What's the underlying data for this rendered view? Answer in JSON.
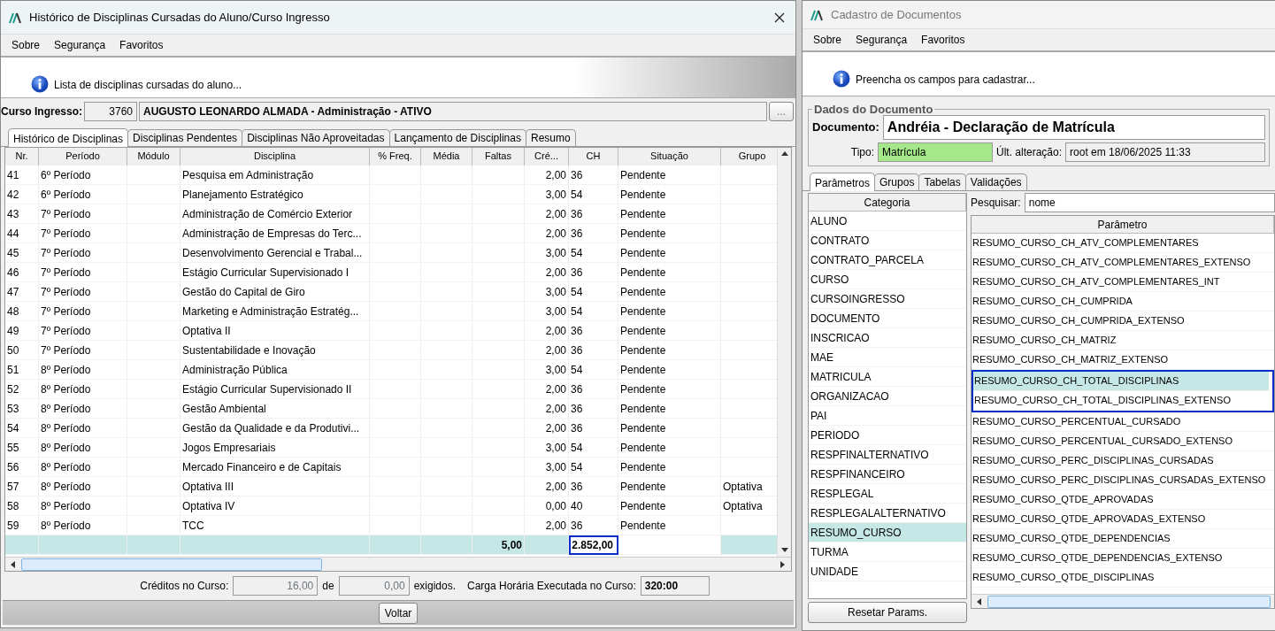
{
  "left_window": {
    "title": "Histórico de Disciplinas Cursadas do Aluno/Curso Ingresso",
    "menu": [
      "Sobre",
      "Segurança",
      "Favoritos"
    ],
    "info": "Lista de disciplinas cursadas do aluno...",
    "curso_ingresso": {
      "label": "Curso Ingresso:",
      "code": "3760",
      "name": "AUGUSTO LEONARDO ALMADA - Administração - ATIVO",
      "button": "..."
    },
    "tabs": [
      {
        "label": "Histórico de Disciplinas",
        "selected": true
      },
      {
        "label": "Disciplinas Pendentes",
        "selected": false
      },
      {
        "label": "Disciplinas Não Aproveitadas",
        "selected": false
      },
      {
        "label": "Lançamento de Disciplinas",
        "selected": false
      },
      {
        "label": "Resumo",
        "selected": false
      }
    ],
    "table": {
      "columns": [
        "Nr.",
        "Período",
        "Módulo",
        "Disciplina",
        "% Freq.",
        "Média",
        "Faltas",
        "Cré...",
        "CH",
        "Situação",
        "Grupo"
      ],
      "rows": [
        {
          "nr": "41",
          "periodo": "6º Período",
          "disciplina": "Pesquisa em Administração",
          "creditos": "2,00",
          "ch": "36",
          "situacao": "Pendente"
        },
        {
          "nr": "42",
          "periodo": "6º Período",
          "disciplina": "Planejamento Estratégico",
          "creditos": "3,00",
          "ch": "54",
          "situacao": "Pendente"
        },
        {
          "nr": "43",
          "periodo": "7º Período",
          "disciplina": "Administração de Comércio Exterior",
          "creditos": "2,00",
          "ch": "36",
          "situacao": "Pendente"
        },
        {
          "nr": "44",
          "periodo": "7º Período",
          "disciplina": "Administração de Empresas do Terc...",
          "creditos": "2,00",
          "ch": "36",
          "situacao": "Pendente"
        },
        {
          "nr": "45",
          "periodo": "7º Período",
          "disciplina": "Desenvolvimento Gerencial e Trabal...",
          "creditos": "3,00",
          "ch": "54",
          "situacao": "Pendente"
        },
        {
          "nr": "46",
          "periodo": "7º Período",
          "disciplina": "Estágio Curricular Supervisionado I",
          "creditos": "2,00",
          "ch": "36",
          "situacao": "Pendente"
        },
        {
          "nr": "47",
          "periodo": "7º Período",
          "disciplina": "Gestão do Capital de Giro",
          "creditos": "3,00",
          "ch": "54",
          "situacao": "Pendente"
        },
        {
          "nr": "48",
          "periodo": "7º Período",
          "disciplina": "Marketing e Administração Estratég...",
          "creditos": "3,00",
          "ch": "54",
          "situacao": "Pendente"
        },
        {
          "nr": "49",
          "periodo": "7º Período",
          "disciplina": "Optativa II",
          "creditos": "2,00",
          "ch": "36",
          "situacao": "Pendente"
        },
        {
          "nr": "50",
          "periodo": "7º Período",
          "disciplina": "Sustentabilidade e Inovação",
          "creditos": "2,00",
          "ch": "36",
          "situacao": "Pendente"
        },
        {
          "nr": "51",
          "periodo": "8º Período",
          "disciplina": "Administração Pública",
          "creditos": "3,00",
          "ch": "54",
          "situacao": "Pendente"
        },
        {
          "nr": "52",
          "periodo": "8º Período",
          "disciplina": "Estágio Curricular Supervisionado II",
          "creditos": "2,00",
          "ch": "36",
          "situacao": "Pendente"
        },
        {
          "nr": "53",
          "periodo": "8º Período",
          "disciplina": "Gestão Ambiental",
          "creditos": "2,00",
          "ch": "36",
          "situacao": "Pendente"
        },
        {
          "nr": "54",
          "periodo": "8º Período",
          "disciplina": "Gestão da Qualidade e da Produtivi...",
          "creditos": "2,00",
          "ch": "36",
          "situacao": "Pendente"
        },
        {
          "nr": "55",
          "periodo": "8º Período",
          "disciplina": "Jogos Empresariais",
          "creditos": "3,00",
          "ch": "54",
          "situacao": "Pendente"
        },
        {
          "nr": "56",
          "periodo": "8º Período",
          "disciplina": "Mercado Financeiro e de Capitais",
          "creditos": "3,00",
          "ch": "54",
          "situacao": "Pendente"
        },
        {
          "nr": "57",
          "periodo": "8º Período",
          "disciplina": "Optativa III",
          "creditos": "2,00",
          "ch": "36",
          "situacao": "Pendente",
          "grupo": "Optativa"
        },
        {
          "nr": "58",
          "periodo": "8º Período",
          "disciplina": "Optativa IV",
          "creditos": "0,00",
          "ch": "40",
          "situacao": "Pendente",
          "grupo": "Optativa"
        },
        {
          "nr": "59",
          "periodo": "8º Período",
          "disciplina": "TCC",
          "creditos": "2,00",
          "ch": "36",
          "situacao": "Pendente"
        }
      ],
      "totals": {
        "faltas": "5,00",
        "ch": "2.852,00",
        "ch_marked": true
      }
    },
    "footer": {
      "creditos_label": "Créditos no Curso:",
      "creditos": "16,00",
      "de": "de",
      "exigidos_value": "0,00",
      "exigidos": "exigidos.",
      "carga_label": "Carga Horária Executada no Curso:",
      "carga": "320:00"
    },
    "button": "Voltar"
  },
  "right_window": {
    "title": "Cadastro de Documentos",
    "menu": [
      "Sobre",
      "Segurança",
      "Favoritos"
    ],
    "info": "Preencha os campos para cadastrar...",
    "group_title": "Dados do Documento",
    "documento": {
      "label": "Documento:",
      "value": "Andréia - Declaração de Matrícula"
    },
    "tipo": {
      "label": "Tipo:",
      "value": "Matrícula",
      "color": "#a4e88a"
    },
    "ult": {
      "label": "Últ. alteração:",
      "value": "root em 18/06/2025 11:33"
    },
    "tabs": [
      {
        "label": "Parâmetros",
        "selected": true
      },
      {
        "label": "Grupos",
        "selected": false
      },
      {
        "label": "Tabelas",
        "selected": false
      },
      {
        "label": "Validações",
        "selected": false
      }
    ],
    "category_header": "Categoria",
    "categories": [
      {
        "label": "ALUNO",
        "selected": false
      },
      {
        "label": "CONTRATO",
        "selected": false
      },
      {
        "label": "CONTRATO_PARCELA",
        "selected": false
      },
      {
        "label": "CURSO",
        "selected": false
      },
      {
        "label": "CURSOINGRESSO",
        "selected": false
      },
      {
        "label": "DOCUMENTO",
        "selected": false
      },
      {
        "label": "INSCRICAO",
        "selected": false
      },
      {
        "label": "MAE",
        "selected": false
      },
      {
        "label": "MATRICULA",
        "selected": false
      },
      {
        "label": "ORGANIZACAO",
        "selected": false
      },
      {
        "label": "PAI",
        "selected": false
      },
      {
        "label": "PERIODO",
        "selected": false
      },
      {
        "label": "RESPFINALTERNATIVO",
        "selected": false
      },
      {
        "label": "RESPFINANCEIRO",
        "selected": false
      },
      {
        "label": "RESPLEGAL",
        "selected": false
      },
      {
        "label": "RESPLEGALALTERNATIVO",
        "selected": false
      },
      {
        "label": "RESUMO_CURSO",
        "selected": true
      },
      {
        "label": "TURMA",
        "selected": false
      },
      {
        "label": "UNIDADE",
        "selected": false
      }
    ],
    "reset_button": "Resetar Params.",
    "search": {
      "label": "Pesquisar:",
      "value": "nome"
    },
    "param_header": "Parâmetro",
    "params": [
      {
        "label": "RESUMO_CURSO_CH_ATV_COMPLEMENTARES",
        "selected": false,
        "marked": false
      },
      {
        "label": "RESUMO_CURSO_CH_ATV_COMPLEMENTARES_EXTENSO",
        "selected": false,
        "marked": false
      },
      {
        "label": "RESUMO_CURSO_CH_ATV_COMPLEMENTARES_INT",
        "selected": false,
        "marked": false
      },
      {
        "label": "RESUMO_CURSO_CH_CUMPRIDA",
        "selected": false,
        "marked": false
      },
      {
        "label": "RESUMO_CURSO_CH_CUMPRIDA_EXTENSO",
        "selected": false,
        "marked": false
      },
      {
        "label": "RESUMO_CURSO_CH_MATRIZ",
        "selected": false,
        "marked": false
      },
      {
        "label": "RESUMO_CURSO_CH_MATRIZ_EXTENSO",
        "selected": false,
        "marked": false
      },
      {
        "label": "RESUMO_CURSO_CH_TOTAL_DISCIPLINAS",
        "selected": true,
        "marked": true
      },
      {
        "label": "RESUMO_CURSO_CH_TOTAL_DISCIPLINAS_EXTENSO",
        "selected": false,
        "marked": true
      },
      {
        "label": "RESUMO_CURSO_PERCENTUAL_CURSADO",
        "selected": false,
        "marked": false
      },
      {
        "label": "RESUMO_CURSO_PERCENTUAL_CURSADO_EXTENSO",
        "selected": false,
        "marked": false
      },
      {
        "label": "RESUMO_CURSO_PERC_DISCIPLINAS_CURSADAS",
        "selected": false,
        "marked": false
      },
      {
        "label": "RESUMO_CURSO_PERC_DISCIPLINAS_CURSADAS_EXTENSO",
        "selected": false,
        "marked": false
      },
      {
        "label": "RESUMO_CURSO_QTDE_APROVADAS",
        "selected": false,
        "marked": false
      },
      {
        "label": "RESUMO_CURSO_QTDE_APROVADAS_EXTENSO",
        "selected": false,
        "marked": false
      },
      {
        "label": "RESUMO_CURSO_QTDE_DEPENDENCIAS",
        "selected": false,
        "marked": false
      },
      {
        "label": "RESUMO_CURSO_QTDE_DEPENDENCIAS_EXTENSO",
        "selected": false,
        "marked": false
      },
      {
        "label": "RESUMO_CURSO_QTDE_DISCIPLINAS",
        "selected": false,
        "marked": false
      }
    ]
  }
}
